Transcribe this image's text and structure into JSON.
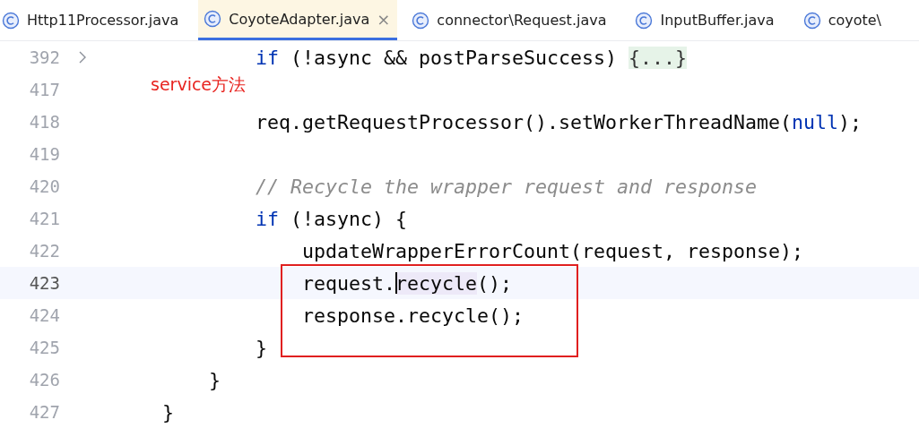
{
  "tabs": [
    {
      "label": "Http11Processor.java",
      "selected": false
    },
    {
      "label": "CoyoteAdapter.java",
      "selected": true,
      "close": "×"
    },
    {
      "label": "connector\\Request.java",
      "selected": false
    },
    {
      "label": "InputBuffer.java",
      "selected": false
    },
    {
      "label": "coyote\\",
      "selected": false
    }
  ],
  "editor": {
    "lines": [
      {
        "number": "392",
        "folded": true,
        "current": false,
        "tokens": [
          {
            "kind": "keyword",
            "text": "            if"
          },
          {
            "kind": "plain",
            "text": " (!async && postParseSuccess) "
          },
          {
            "kind": "fold",
            "text": "{...}"
          }
        ]
      },
      {
        "number": "417",
        "folded": false,
        "current": false
      },
      {
        "number": "418",
        "folded": false,
        "current": false,
        "tokens": [
          {
            "kind": "plain",
            "text": "            req.getRequestProcessor().setWorkerThreadName("
          },
          {
            "kind": "keyword",
            "text": "null"
          },
          {
            "kind": "plain",
            "text": ");"
          }
        ]
      },
      {
        "number": "419",
        "folded": false,
        "current": false
      },
      {
        "number": "420",
        "folded": false,
        "current": false,
        "tokens": [
          {
            "kind": "comment",
            "text": "            // Recycle the wrapper request and response"
          }
        ]
      },
      {
        "number": "421",
        "folded": false,
        "current": false,
        "tokens": [
          {
            "kind": "keyword",
            "text": "            if"
          },
          {
            "kind": "plain",
            "text": " (!async) {"
          }
        ]
      },
      {
        "number": "422",
        "folded": false,
        "current": false,
        "tokens": [
          {
            "kind": "plain",
            "text": "                updateWrapperErrorCount(request, response);"
          }
        ]
      },
      {
        "number": "423",
        "folded": false,
        "current": true,
        "tokens": [
          {
            "kind": "plain",
            "text": "                request."
          },
          {
            "kind": "caret"
          },
          {
            "kind": "usage",
            "text": "recycle"
          },
          {
            "kind": "plain",
            "text": "();"
          }
        ]
      },
      {
        "number": "424",
        "folded": false,
        "current": false,
        "tokens": [
          {
            "kind": "plain",
            "text": "                response.recycle();"
          }
        ]
      },
      {
        "number": "425",
        "folded": false,
        "current": false,
        "tokens": [
          {
            "kind": "plain",
            "text": "            }"
          }
        ]
      },
      {
        "number": "426",
        "folded": false,
        "current": false,
        "tokens": [
          {
            "kind": "plain",
            "text": "        }"
          }
        ]
      },
      {
        "number": "427",
        "folded": false,
        "current": false,
        "tokens": [
          {
            "kind": "plain",
            "text": "    }"
          }
        ]
      }
    ]
  },
  "annotation": {
    "note": "service方法"
  }
}
